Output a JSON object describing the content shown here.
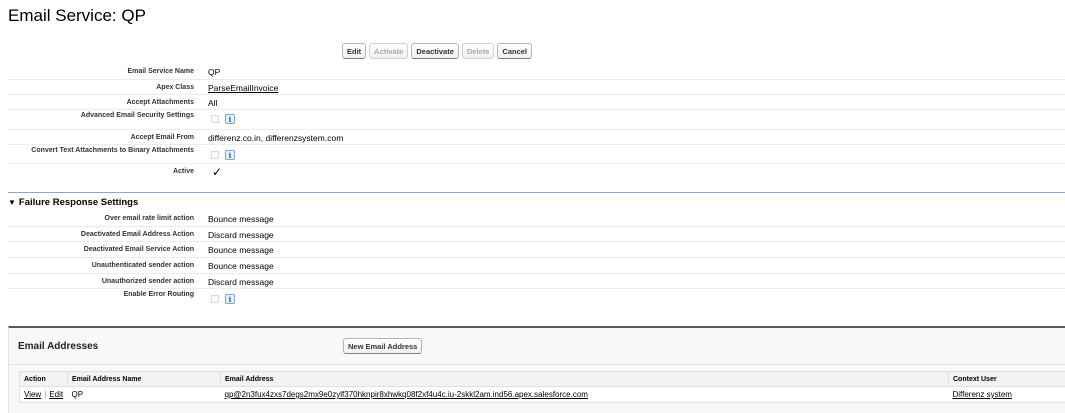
{
  "page": {
    "title": "Email Service: QP"
  },
  "toolbar": {
    "edit": "Edit",
    "activate": "Activate",
    "deactivate": "Deactivate",
    "delete": "Delete",
    "cancel": "Cancel"
  },
  "details": [
    {
      "label": "Email Service Name",
      "value": "QP"
    },
    {
      "label": "Apex Class",
      "value": "ParseEmailInvoice"
    },
    {
      "label": "Accept Attachments",
      "value": "All"
    },
    {
      "label": "Advanced Email Security Settings",
      "value": ""
    },
    {
      "label": "Accept Email From",
      "value": "differenz.co.in, differenzsystem.com"
    },
    {
      "label": "Convert Text Attachments to Binary Attachments",
      "value": ""
    },
    {
      "label": "Active",
      "value": "✓"
    }
  ],
  "failure": {
    "title": "Failure Response Settings",
    "rows": [
      {
        "label": "Over email rate limit action",
        "value": "Bounce message"
      },
      {
        "label": "Deactivated Email Address Action",
        "value": "Discard message"
      },
      {
        "label": "Deactivated Email Service Action",
        "value": "Bounce message"
      },
      {
        "label": "Unauthenticated sender action",
        "value": "Bounce message"
      },
      {
        "label": "Unauthorized sender action",
        "value": "Discard message"
      },
      {
        "label": "Enable Error Routing",
        "value": ""
      }
    ]
  },
  "addresses": {
    "title": "Email Addresses",
    "new_button": "New Email Address",
    "columns": [
      "Action",
      "Email Address Name",
      "Email Address",
      "Context User"
    ],
    "rows": [
      {
        "view": "View",
        "edit": "Edit",
        "name": "QP",
        "address": "qp@2n3fux4zxs7degs2mx9e0zylf370hknpir8xhwkq08f2xf4u4c.iu-2skkl2am.ind56.apex.salesforce.com",
        "user": "Differenz system"
      }
    ]
  },
  "icons": {
    "info": "info-icon",
    "check": "checkmark-icon",
    "collapse": "triangle-down-icon"
  }
}
